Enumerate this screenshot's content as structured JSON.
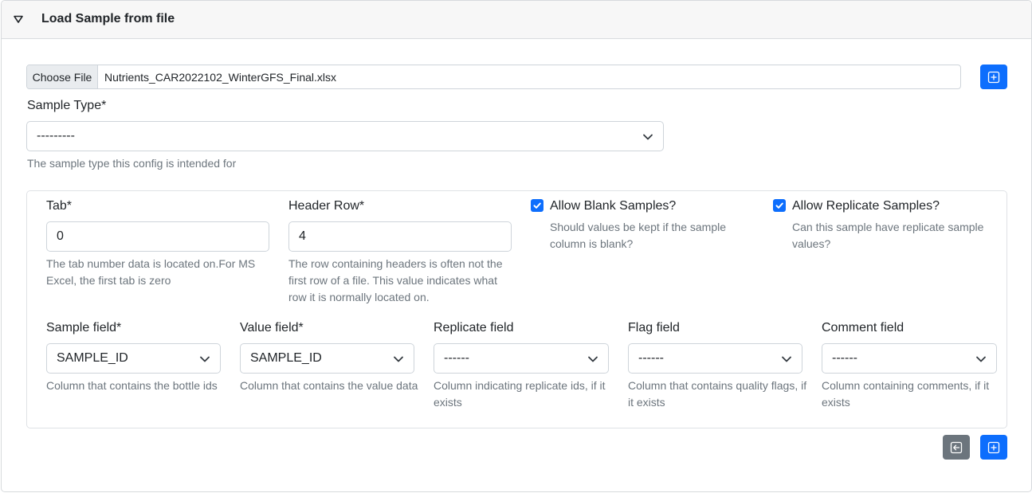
{
  "header": {
    "title": "Load Sample from file"
  },
  "file": {
    "button_label": "Choose File",
    "filename": "Nutrients_CAR2022102_WinterGFS_Final.xlsx"
  },
  "sample_type": {
    "label": "Sample Type*",
    "value": "---------",
    "help": "The sample type this config is intended for"
  },
  "config": {
    "tab": {
      "label": "Tab*",
      "value": "0",
      "help": "The tab number data is located on.For MS Excel, the first tab is zero"
    },
    "header_row": {
      "label": "Header Row*",
      "value": "4",
      "help": "The row containing headers is often not the first row of a file. This value indicates what row it is normally located on."
    },
    "allow_blank": {
      "label": "Allow Blank Samples?",
      "checked": true,
      "help": "Should values be kept if the sample column is blank?"
    },
    "allow_replicate": {
      "label": "Allow Replicate Samples?",
      "checked": true,
      "help": "Can this sample have replicate sample values?"
    },
    "fields": [
      {
        "label": "Sample field*",
        "value": "SAMPLE_ID",
        "help": "Column that contains the bottle ids"
      },
      {
        "label": "Value field*",
        "value": "SAMPLE_ID",
        "help": "Column that contains the value data"
      },
      {
        "label": "Replicate field",
        "value": "------",
        "help": "Column indicating replicate ids, if it exists"
      },
      {
        "label": "Flag field",
        "value": "------",
        "help": "Column that contains quality flags, if it exists"
      },
      {
        "label": "Comment field",
        "value": "------",
        "help": "Column containing comments, if it exists"
      }
    ]
  },
  "colors": {
    "primary": "#0d6efd",
    "secondary": "#6c757d",
    "help_text": "#6c757d"
  },
  "icons": {
    "toggle": "caret-down-outline-icon",
    "add": "plus-square-icon",
    "back": "arrow-left-square-icon",
    "chevron": "chevron-down-icon",
    "check": "check-icon"
  }
}
